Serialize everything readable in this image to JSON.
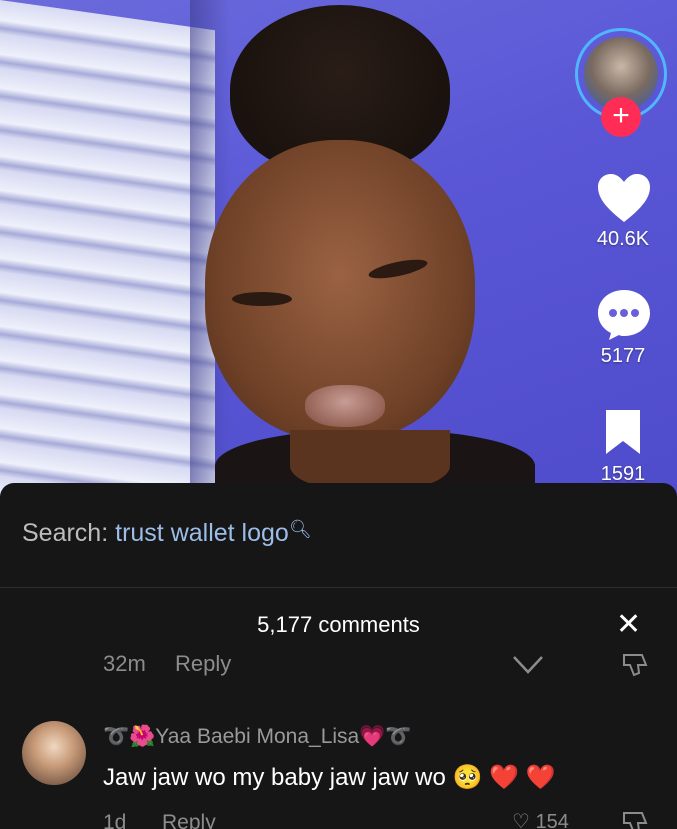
{
  "video": {
    "like_count": "40.6K",
    "comment_count": "5177",
    "save_count": "1591"
  },
  "sheet": {
    "search_prefix": "Search:",
    "search_term": "trust wallet logo",
    "comments_title": "5,177 comments"
  },
  "prev_comment": {
    "time": "32m",
    "reply_label": "Reply"
  },
  "comment": {
    "username": "Yaa Baebi Mona_Lisa",
    "text": "Jaw jaw wo my baby jaw jaw wo",
    "time": "1d",
    "reply_label": "Reply",
    "likes": "154"
  },
  "colors": {
    "accent_follow": "#ff2d55",
    "search_link": "#9bbde8",
    "sheet_bg": "#161616"
  },
  "icons": [
    "heart-icon",
    "comment-bubble-icon",
    "bookmark-icon",
    "plus-icon",
    "close-icon",
    "search-icon",
    "dislike-icon"
  ]
}
